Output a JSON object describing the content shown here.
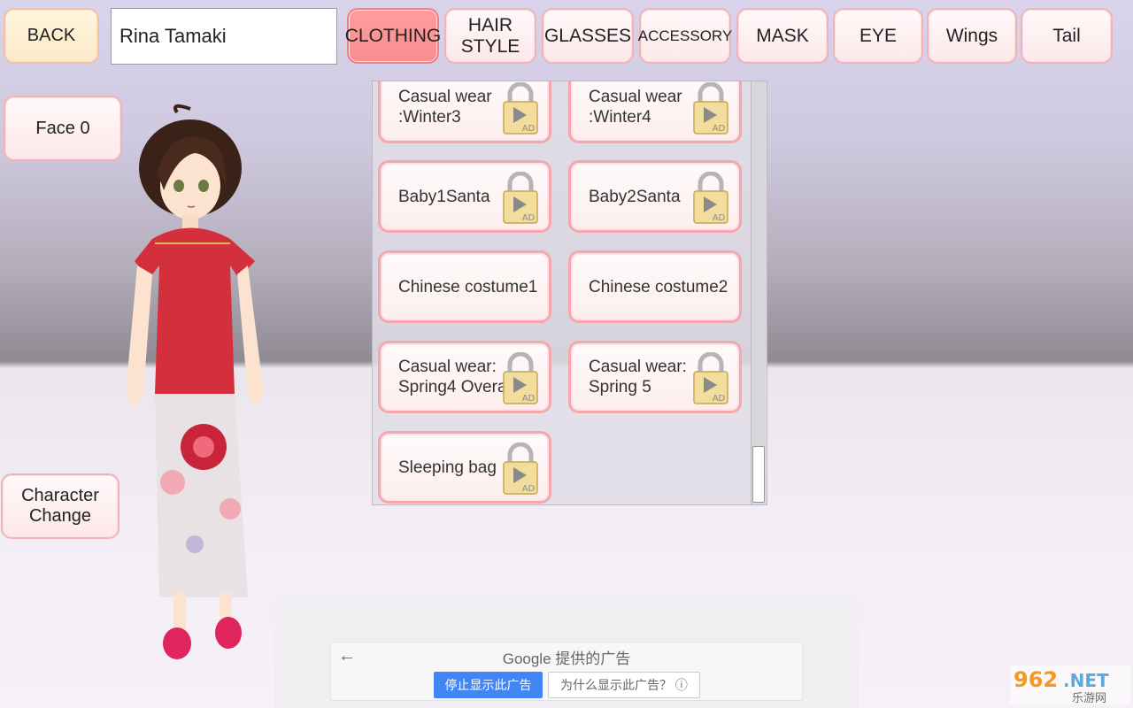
{
  "top": {
    "back_label": "BACK",
    "character_name": "Rina Tamaki",
    "tabs": [
      {
        "label": "CLOTHING",
        "active": true
      },
      {
        "label": "HAIR\nSTYLE"
      },
      {
        "label": "GLASSES"
      },
      {
        "label": "ACCESSORY"
      },
      {
        "label": "MASK"
      },
      {
        "label": "EYE"
      },
      {
        "label": "Wings"
      },
      {
        "label": "Tail"
      }
    ]
  },
  "left": {
    "face_label": "Face 0",
    "character_change_label": "Character\nChange"
  },
  "clothing_items": [
    {
      "label": "Casual wear\n:Winter3",
      "locked": true
    },
    {
      "label": "Casual wear\n:Winter4",
      "locked": true
    },
    {
      "label": "Baby1Santa",
      "locked": true
    },
    {
      "label": "Baby2Santa",
      "locked": true
    },
    {
      "label": "Chinese costume1",
      "locked": false
    },
    {
      "label": "Chinese costume2",
      "locked": false
    },
    {
      "label": "Casual wear:\nSpring4 Overalls",
      "locked": true
    },
    {
      "label": "Casual wear:\nSpring 5",
      "locked": true
    },
    {
      "label": "Sleeping bag",
      "locked": true
    }
  ],
  "lock_badge": "AD",
  "ad": {
    "title": "Google 提供的广告",
    "stop_label": "停止显示此广告",
    "why_label": "为什么显示此广告？ ⓘ"
  },
  "watermark": {
    "text": "962.NET",
    "subtext": "乐游网"
  }
}
